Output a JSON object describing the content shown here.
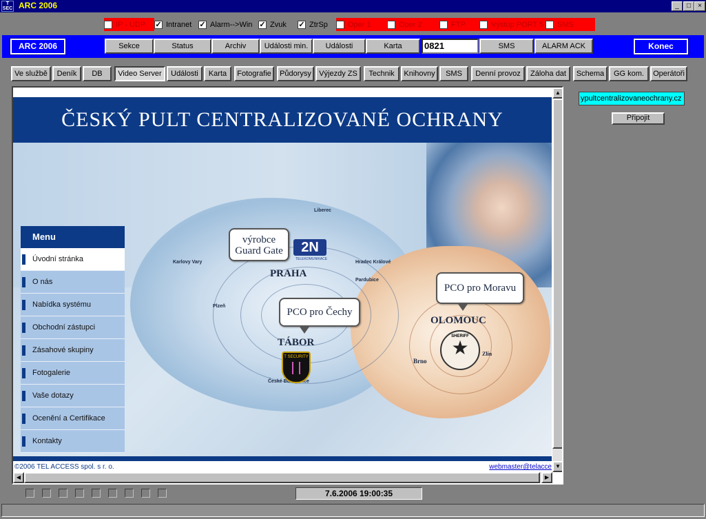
{
  "window": {
    "title": "ARC 2006",
    "icon_text_top": "T",
    "icon_text_bottom": "SEC",
    "controls": [
      "_",
      "□",
      "×"
    ]
  },
  "checkboxes": [
    {
      "label": "IP - UDP",
      "checked": false,
      "highlight": "red"
    },
    {
      "label": "Intranet",
      "checked": true
    },
    {
      "label": "Alarm-->Win",
      "checked": true
    },
    {
      "label": "Zvuk",
      "checked": true
    },
    {
      "label": "ZtrSp",
      "checked": true
    },
    {
      "label": "Oper 1",
      "checked": false,
      "highlight": "red"
    },
    {
      "label": "Oper 2",
      "checked": false,
      "highlight": "red"
    },
    {
      "label": "FTP",
      "checked": false,
      "highlight": "red"
    },
    {
      "label": "Výstup PORT 5",
      "checked": false,
      "highlight": "red"
    },
    {
      "label": "SMS",
      "checked": false,
      "highlight": "red"
    }
  ],
  "check_mark": "✓",
  "toolbar": {
    "app_label": "ARC 2006",
    "buttons": [
      "Sekce",
      "Status",
      "Archiv",
      "Události min.",
      "Události",
      "Karta"
    ],
    "event_count": "0821",
    "sms": "SMS",
    "alarm_ack": "ALARM ACK",
    "exit": "Konec"
  },
  "tabs": [
    {
      "label": "Ve službě"
    },
    {
      "label": "Deník"
    },
    {
      "label": "DB"
    },
    {
      "label": "Video Server",
      "active": true
    },
    {
      "label": "Události"
    },
    {
      "label": "Karta"
    },
    {
      "label": "Fotografie"
    },
    {
      "label": "Půdorysy"
    },
    {
      "label": "Výjezdy ZS"
    },
    {
      "label": "Technik"
    },
    {
      "label": "Knihovny"
    },
    {
      "label": "SMS"
    },
    {
      "label": "Denní provoz"
    },
    {
      "label": "Záloha dat"
    },
    {
      "label": "Schema"
    },
    {
      "label": "GG kom."
    },
    {
      "label": "Operátoři"
    }
  ],
  "web": {
    "title": "ČESKÝ PULT CENTRALIZOVANÉ OCHRANY",
    "menu_title": "Menu",
    "menu": [
      {
        "label": "Úvodní stránka",
        "selected": true
      },
      {
        "label": "O nás"
      },
      {
        "label": "Nabídka systému"
      },
      {
        "label": "Obchodní zástupci"
      },
      {
        "label": "Zásahové skupiny"
      },
      {
        "label": "Fotogalerie"
      },
      {
        "label": "Vaše dotazy"
      },
      {
        "label": "Ocenění a Certifikace"
      },
      {
        "label": "Kontakty"
      }
    ],
    "bubbles": {
      "guard_gate": [
        "výrobce",
        "Guard Gate"
      ],
      "cechy": "PCO pro Čechy",
      "morava": "PCO pro Moravu"
    },
    "logos": {
      "two_n": "2N",
      "two_n_sub": "TELEKOMUNIKACE",
      "tsecurity": "T SECURITY",
      "sheriff": "SHERIFF"
    },
    "cities": {
      "praha": "PRAHA",
      "tabor": "TÁBOR",
      "olomouc": "OLOMOUC",
      "brno": "Brno",
      "zlin": "Zlín",
      "liberec": "Liberec",
      "plzen": "Plzeň",
      "pardubice": "Pardubice",
      "hradec": "Hradec Králové",
      "karlovy_vary": "Karlovy Vary",
      "budejovice": "České Budějovice"
    },
    "copyright": "©2006 TEL ACCESS spol. s r. o.",
    "webmaster": "webmaster@telacce"
  },
  "side": {
    "url": "ypultcentralizovaneochrany.cz",
    "connect": "Připojit"
  },
  "status": {
    "datetime": "7.6.2006  19:00:35"
  }
}
